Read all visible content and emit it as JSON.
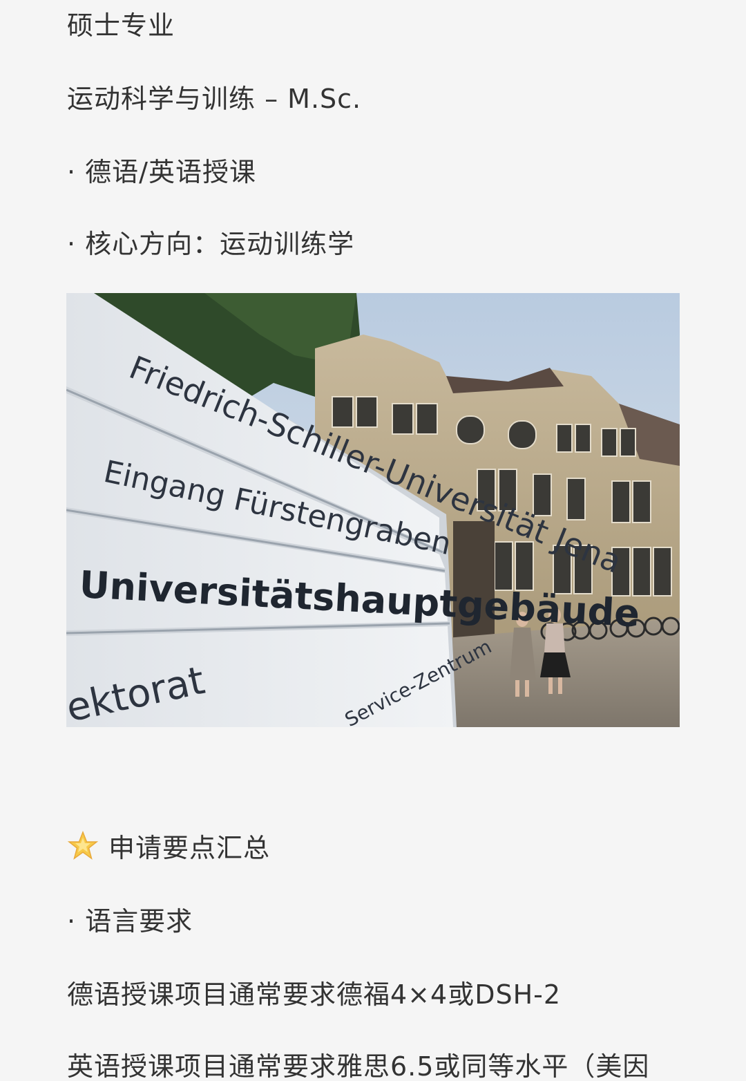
{
  "article": {
    "heading": "硕士专业",
    "program": "运动科学与训练 – M.Sc.",
    "bullet_language": "· 德语/英语授课",
    "bullet_focus": "· 核心方向：运动训练学",
    "photo": {
      "sign_university": "Friedrich-Schiller-Universität Jena",
      "sign_entrance": "Eingang Fürstengraben",
      "sign_building": "Universitätshauptgebäude",
      "sign_rektorat": "ektorat",
      "sign_service": "Service-Zentrum"
    },
    "section_title": "申请要点汇总",
    "section_icon": "star-icon",
    "bullet_requirements": "· 语言要求",
    "german_requirement": "德语授课项目通常要求德福4×4或DSH-2",
    "english_requirement": "英语授课项目通常要求雅思6.5或同等水平（美因"
  },
  "colors": {
    "background": "#f5f5f5",
    "text": "#333333",
    "star": "#f7c948"
  }
}
